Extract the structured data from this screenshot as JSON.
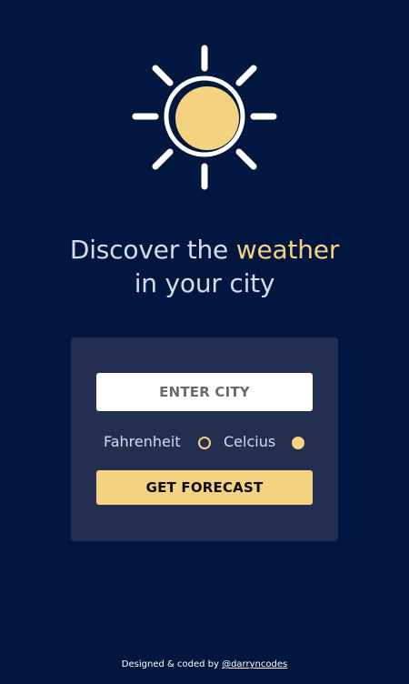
{
  "hero": {
    "icon": "sun-icon",
    "headline_prefix": "Discover the",
    "headline_accent": "weather",
    "headline_line2": "in your city"
  },
  "form": {
    "city_placeholder": "ENTER CITY",
    "city_value": "",
    "units": [
      {
        "label": "Fahrenheit",
        "selected": false
      },
      {
        "label": "Celcius",
        "selected": true
      }
    ],
    "submit_label": "GET FORECAST"
  },
  "footer": {
    "credit_text": "Designed & coded by",
    "credit_link": "@darryncodes"
  },
  "colors": {
    "background": "#021740",
    "card": "#232f50",
    "accent": "#f5d27f",
    "text": "#d5dbe8"
  }
}
